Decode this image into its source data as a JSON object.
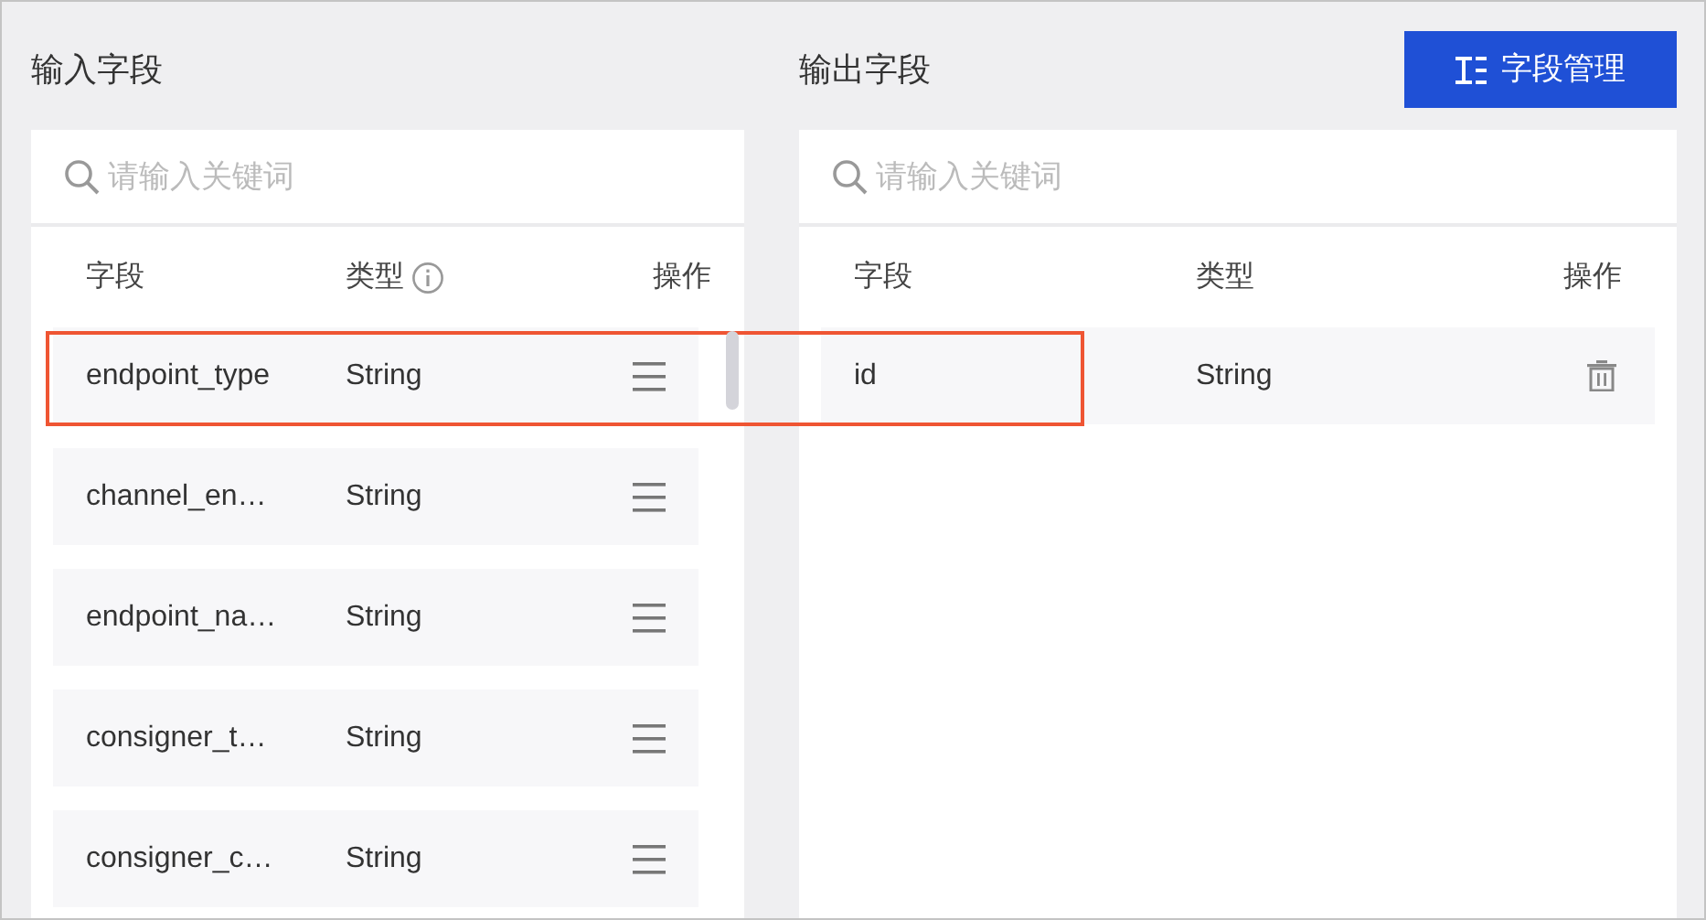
{
  "annotation": {
    "kind": "highlight-frame"
  },
  "input_panel": {
    "title": "输入字段",
    "search": {
      "placeholder": "请输入关键词"
    },
    "columns": [
      {
        "label": "字段"
      },
      {
        "label": "类型",
        "info": true
      },
      {
        "label": "操作"
      }
    ],
    "rows": [
      {
        "field": "endpoint_type",
        "type": "String"
      },
      {
        "field": "channel_en…",
        "type": "String"
      },
      {
        "field": "endpoint_na…",
        "type": "String"
      },
      {
        "field": "consigner_t…",
        "type": "String"
      },
      {
        "field": "consigner_c…",
        "type": "String"
      }
    ]
  },
  "output_panel": {
    "title": "输出字段",
    "button": "字段管理",
    "search": {
      "placeholder": "请输入关键词"
    },
    "columns": [
      {
        "label": "字段"
      },
      {
        "label": "类型"
      },
      {
        "label": "操作"
      }
    ],
    "rows": [
      {
        "field": "id",
        "type": "String"
      }
    ]
  }
}
